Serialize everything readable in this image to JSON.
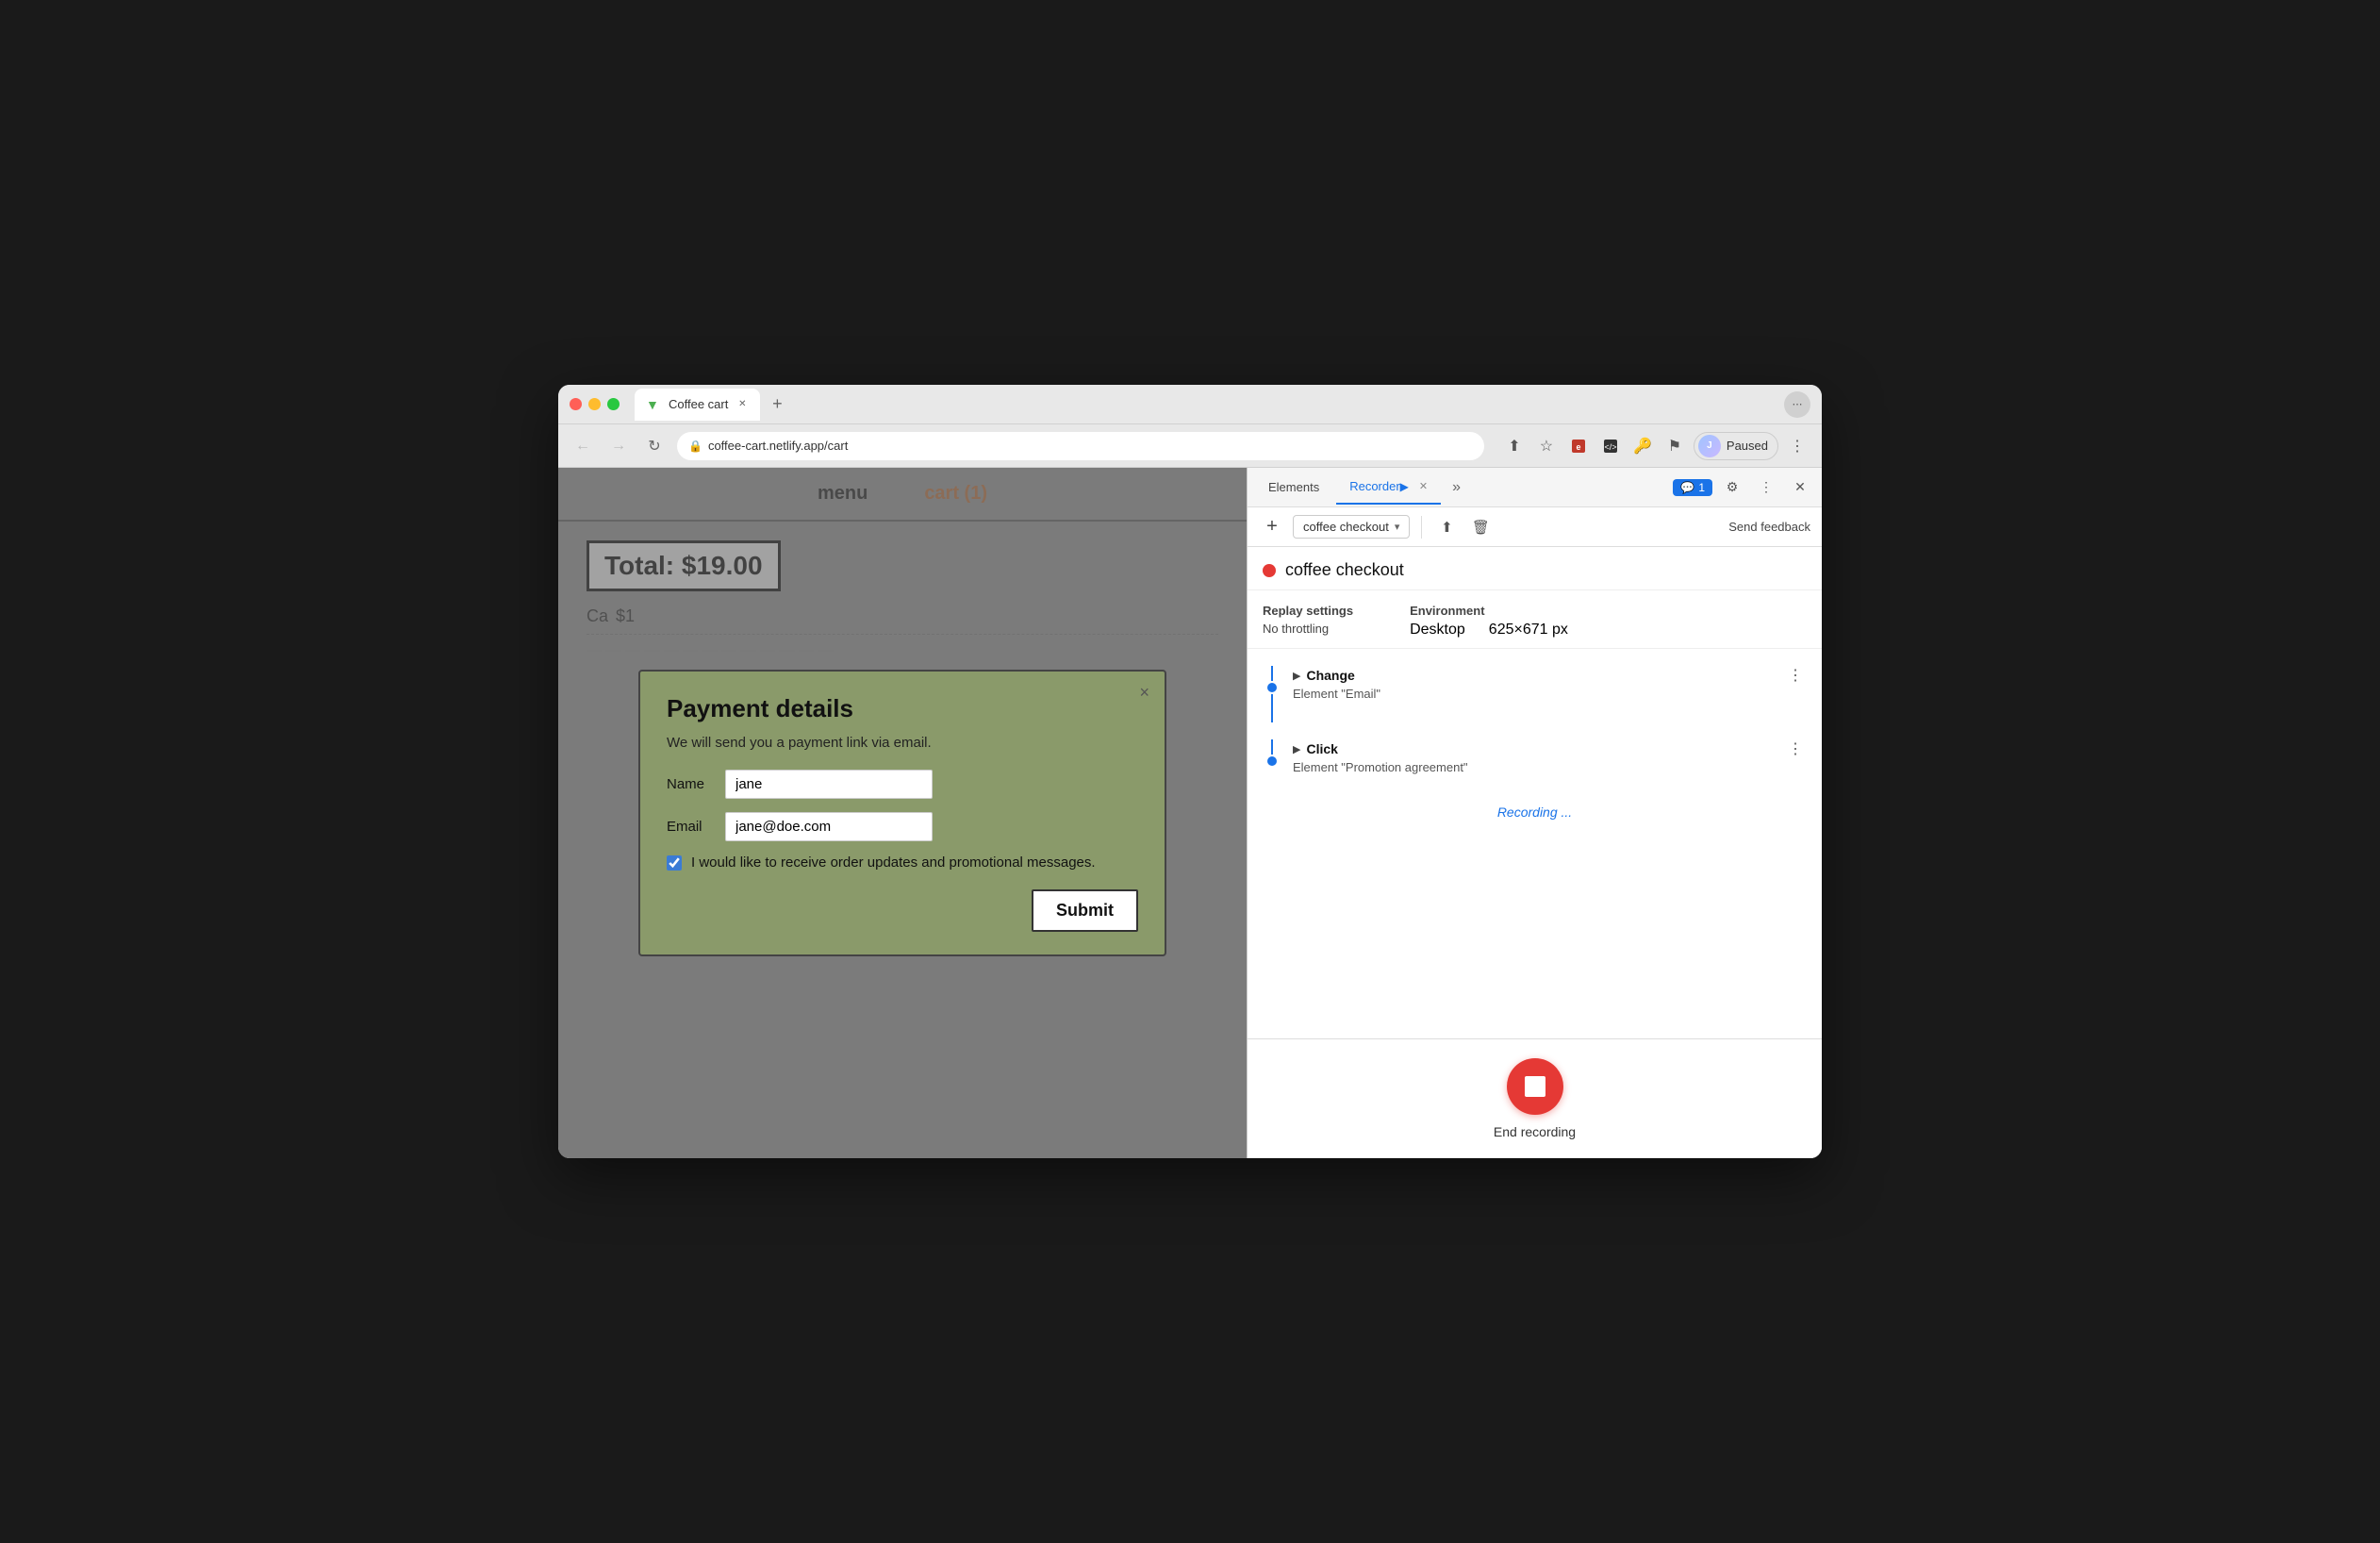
{
  "browser": {
    "title": "Coffee cart",
    "tab_label": "Coffee cart",
    "url": "coffee-cart.netlify.app/cart",
    "paused_label": "Paused"
  },
  "site": {
    "nav": {
      "menu_label": "menu",
      "cart_label": "cart (1)"
    },
    "cart": {
      "total_label": "Total: $19.00",
      "item_name": "Ca",
      "item_price": "$1",
      "dashes": "— — — — — — — — — — — — —"
    }
  },
  "modal": {
    "title": "Payment details",
    "subtitle": "We will send you a payment link via email.",
    "name_label": "Name",
    "name_value": "jane",
    "email_label": "Email",
    "email_value": "jane@doe.com",
    "checkbox_label": "I would like to receive order updates and promotional messages.",
    "submit_label": "Submit",
    "close_label": "×"
  },
  "devtools": {
    "tabs": [
      {
        "label": "Elements",
        "active": false
      },
      {
        "label": "Recorder",
        "active": true,
        "has_indicator": true,
        "has_close": true
      }
    ],
    "more_label": "»",
    "chat_badge": "1",
    "toolbar": {
      "add_label": "+",
      "recording_name": "coffee checkout",
      "export_icon": "⬆",
      "delete_icon": "🗑",
      "send_feedback": "Send feedback"
    },
    "recording": {
      "dot_color": "#e53935",
      "title": "coffee checkout",
      "replay_settings_label": "Replay settings",
      "no_throttling": "No throttling",
      "environment_label": "Environment",
      "desktop_label": "Desktop",
      "dimensions": "625×671 px"
    },
    "events": [
      {
        "type": "Change",
        "element": "Element \"Email\"",
        "has_top_line": true
      },
      {
        "type": "Click",
        "element": "Element \"Promotion agreement\"",
        "has_top_line": true
      }
    ],
    "recording_status": "Recording ...",
    "end_recording_label": "End recording"
  }
}
